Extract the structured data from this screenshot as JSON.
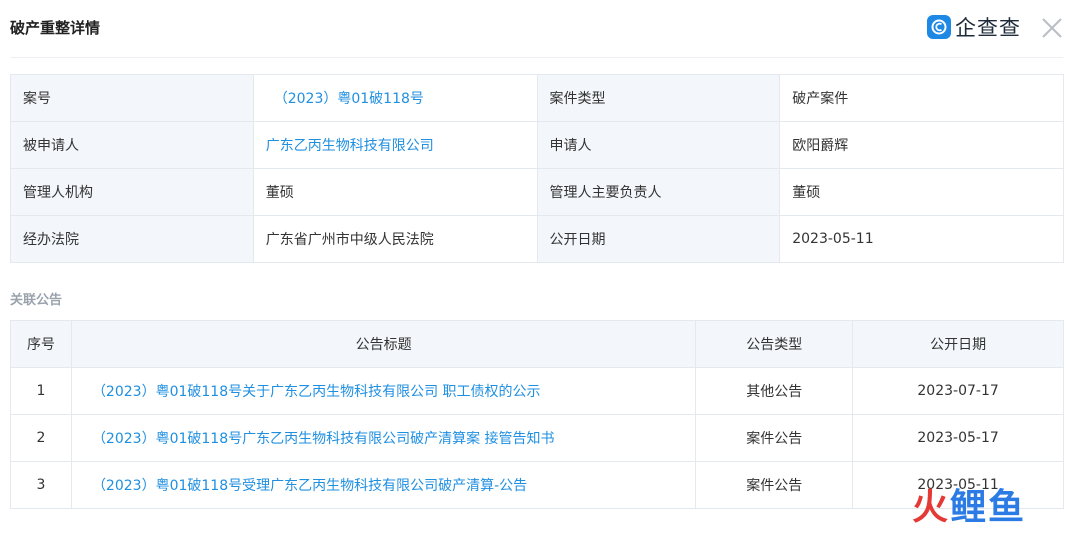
{
  "header": {
    "title": "破产重整详情",
    "brand_name": "企查查"
  },
  "case_info": [
    {
      "label": "案号",
      "value": "（2023）粤01破118号",
      "is_link": true,
      "label2": "案件类型",
      "value2": "破产案件",
      "is_link2": false
    },
    {
      "label": "被申请人",
      "value": "广东乙丙生物科技有限公司",
      "is_link": true,
      "label2": "申请人",
      "value2": "欧阳爵辉",
      "is_link2": false
    },
    {
      "label": "管理人机构",
      "value": "董硕",
      "is_link": false,
      "label2": "管理人主要负责人",
      "value2": "董硕",
      "is_link2": false
    },
    {
      "label": "经办法院",
      "value": "广东省广州市中级人民法院",
      "is_link": false,
      "label2": "公开日期",
      "value2": "2023-05-11",
      "is_link2": false
    }
  ],
  "related": {
    "section_title": "关联公告",
    "columns": [
      "序号",
      "公告标题",
      "公告类型",
      "公开日期"
    ],
    "rows": [
      {
        "no": "1",
        "title": "（2023）粤01破118号关于广东乙丙生物科技有限公司 职工债权的公示",
        "type": "其他公告",
        "date": "2023-07-17"
      },
      {
        "no": "2",
        "title": "（2023）粤01破118号广东乙丙生物科技有限公司破产清算案 接管告知书",
        "type": "案件公告",
        "date": "2023-05-17"
      },
      {
        "no": "3",
        "title": "（2023）粤01破118号受理广东乙丙生物科技有限公司破产清算-公告",
        "type": "案件公告",
        "date": "2023-05-11"
      }
    ]
  },
  "watermark": {
    "part1": "火",
    "part2": "鲤鱼"
  },
  "colors": {
    "link": "#1f8fe0",
    "label_bg": "#f3f6fa",
    "border": "#e4e9f0",
    "brand": "#1e88e5"
  }
}
